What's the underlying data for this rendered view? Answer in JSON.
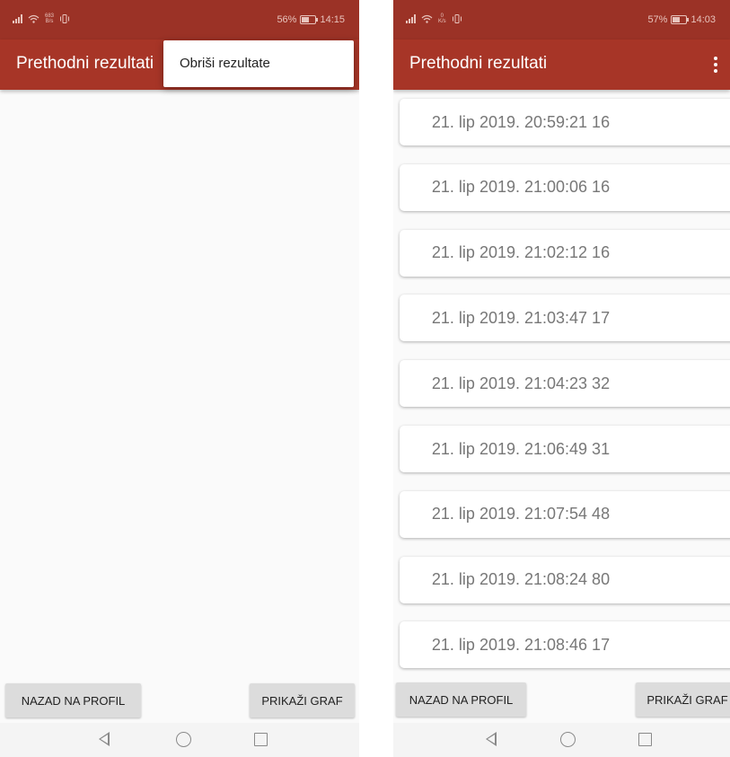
{
  "left_screen": {
    "status": {
      "net_speed_value": "683",
      "net_speed_unit": "B/s",
      "battery": "56%",
      "battery_level": 0.56,
      "time": "14:15"
    },
    "app_bar": {
      "title": "Prethodni rezultati"
    },
    "menu": {
      "item": "Obriši rezultate"
    },
    "buttons": {
      "back": "NAZAD NA PROFIL",
      "graph": "PRIKAŽI GRAF"
    }
  },
  "right_screen": {
    "status": {
      "net_speed_value": "0",
      "net_speed_unit": "K/s",
      "battery": "57%",
      "battery_level": 0.57,
      "time": "14:03"
    },
    "app_bar": {
      "title": "Prethodni rezultati"
    },
    "results": [
      "21. lip 2019. 20:59:21  16",
      "21. lip 2019. 21:00:06  16",
      "21. lip 2019. 21:02:12  16",
      "21. lip 2019. 21:03:47  17",
      "21. lip 2019. 21:04:23  32",
      "21. lip 2019. 21:06:49  31",
      "21. lip 2019. 21:07:54  48",
      "21. lip 2019. 21:08:24  80",
      "21. lip 2019. 21:08:46  17"
    ],
    "buttons": {
      "back": "NAZAD NA PROFIL",
      "graph": "PRIKAŽI GRAF"
    }
  },
  "colors": {
    "status_bar": "#9b3226",
    "app_bar": "#a73527",
    "button": "#dcdcdc",
    "result_text": "#777777"
  },
  "icons": [
    "signal-icon",
    "wifi-icon",
    "vibrate-icon",
    "battery-icon",
    "overflow-menu-icon",
    "nav-back-icon",
    "nav-home-icon",
    "nav-recents-icon"
  ]
}
